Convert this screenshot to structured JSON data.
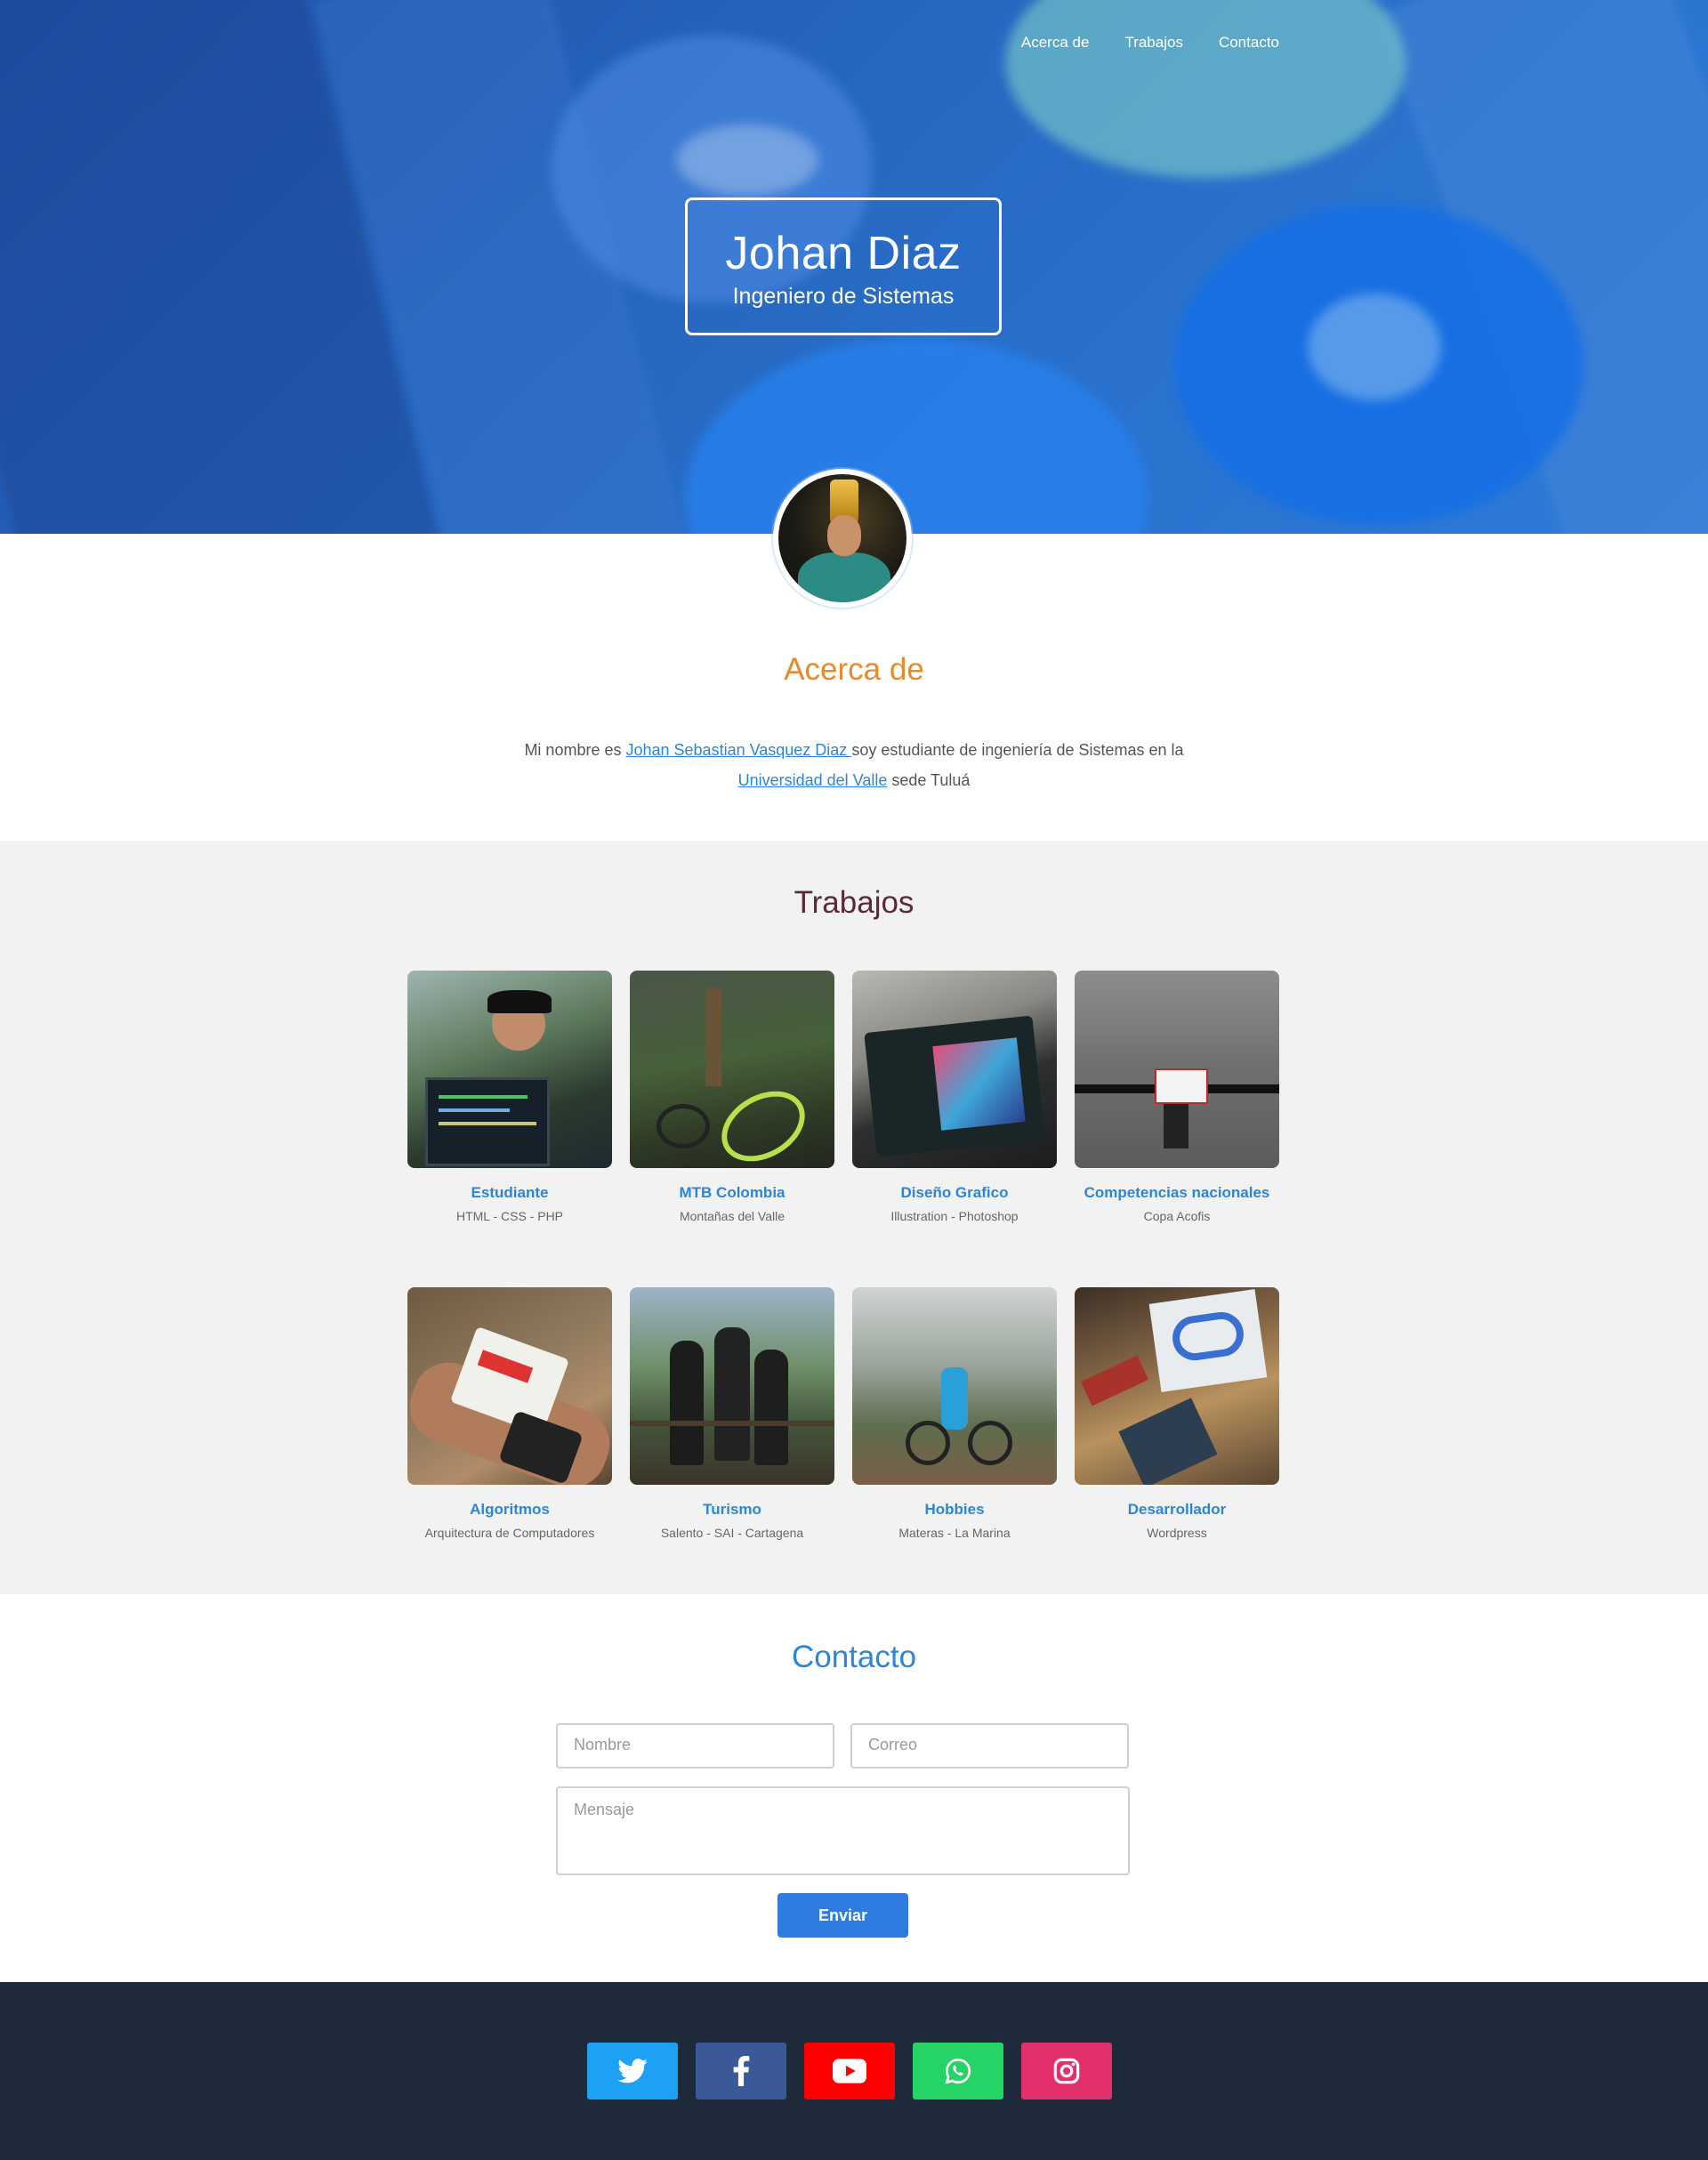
{
  "nav": {
    "items": [
      "Acerca de",
      "Trabajos",
      "Contacto"
    ]
  },
  "hero": {
    "name": "Johan Diaz",
    "role": "Ingeniero de Sistemas"
  },
  "about": {
    "title": "Acerca de",
    "text_before": "Mi nombre es ",
    "link_name": "Johan Sebastian Vasquez Diaz ",
    "text_middle": "soy estudiante de ingeniería de Sistemas en la ",
    "link_university": "Universidad del Valle",
    "text_after": " sede Tuluá"
  },
  "works": {
    "title": "Trabajos",
    "items": [
      {
        "title": "Estudiante",
        "subtitle": "HTML - CSS - PHP"
      },
      {
        "title": "MTB Colombia",
        "subtitle": "Montañas del Valle"
      },
      {
        "title": "Diseño Grafico",
        "subtitle": "Illustration - Photoshop"
      },
      {
        "title": "Competencias nacionales",
        "subtitle": "Copa Acofis"
      },
      {
        "title": "Algoritmos",
        "subtitle": "Arquitectura de Computadores"
      },
      {
        "title": "Turismo",
        "subtitle": "Salento - SAI - Cartagena"
      },
      {
        "title": "Hobbies",
        "subtitle": "Materas - La Marina"
      },
      {
        "title": "Desarrollador",
        "subtitle": "Wordpress"
      }
    ]
  },
  "contact": {
    "title": "Contacto",
    "name_placeholder": "Nombre",
    "email_placeholder": "Correo",
    "message_placeholder": "Mensaje",
    "send_label": "Enviar"
  },
  "footer": {
    "social": [
      {
        "icon": "twitter-icon",
        "color": "#1da1f2"
      },
      {
        "icon": "facebook-icon",
        "color": "#3b5998"
      },
      {
        "icon": "youtube-icon",
        "color": "#ff0000"
      },
      {
        "icon": "whatsapp-icon",
        "color": "#25d366"
      },
      {
        "icon": "instagram-icon",
        "color": "#e1306c"
      }
    ]
  },
  "colors": {
    "accent_orange": "#e88a2c",
    "accent_blue": "#2b86d9",
    "footer_bg": "#1e2939",
    "works_bg": "#f2f2f2"
  }
}
